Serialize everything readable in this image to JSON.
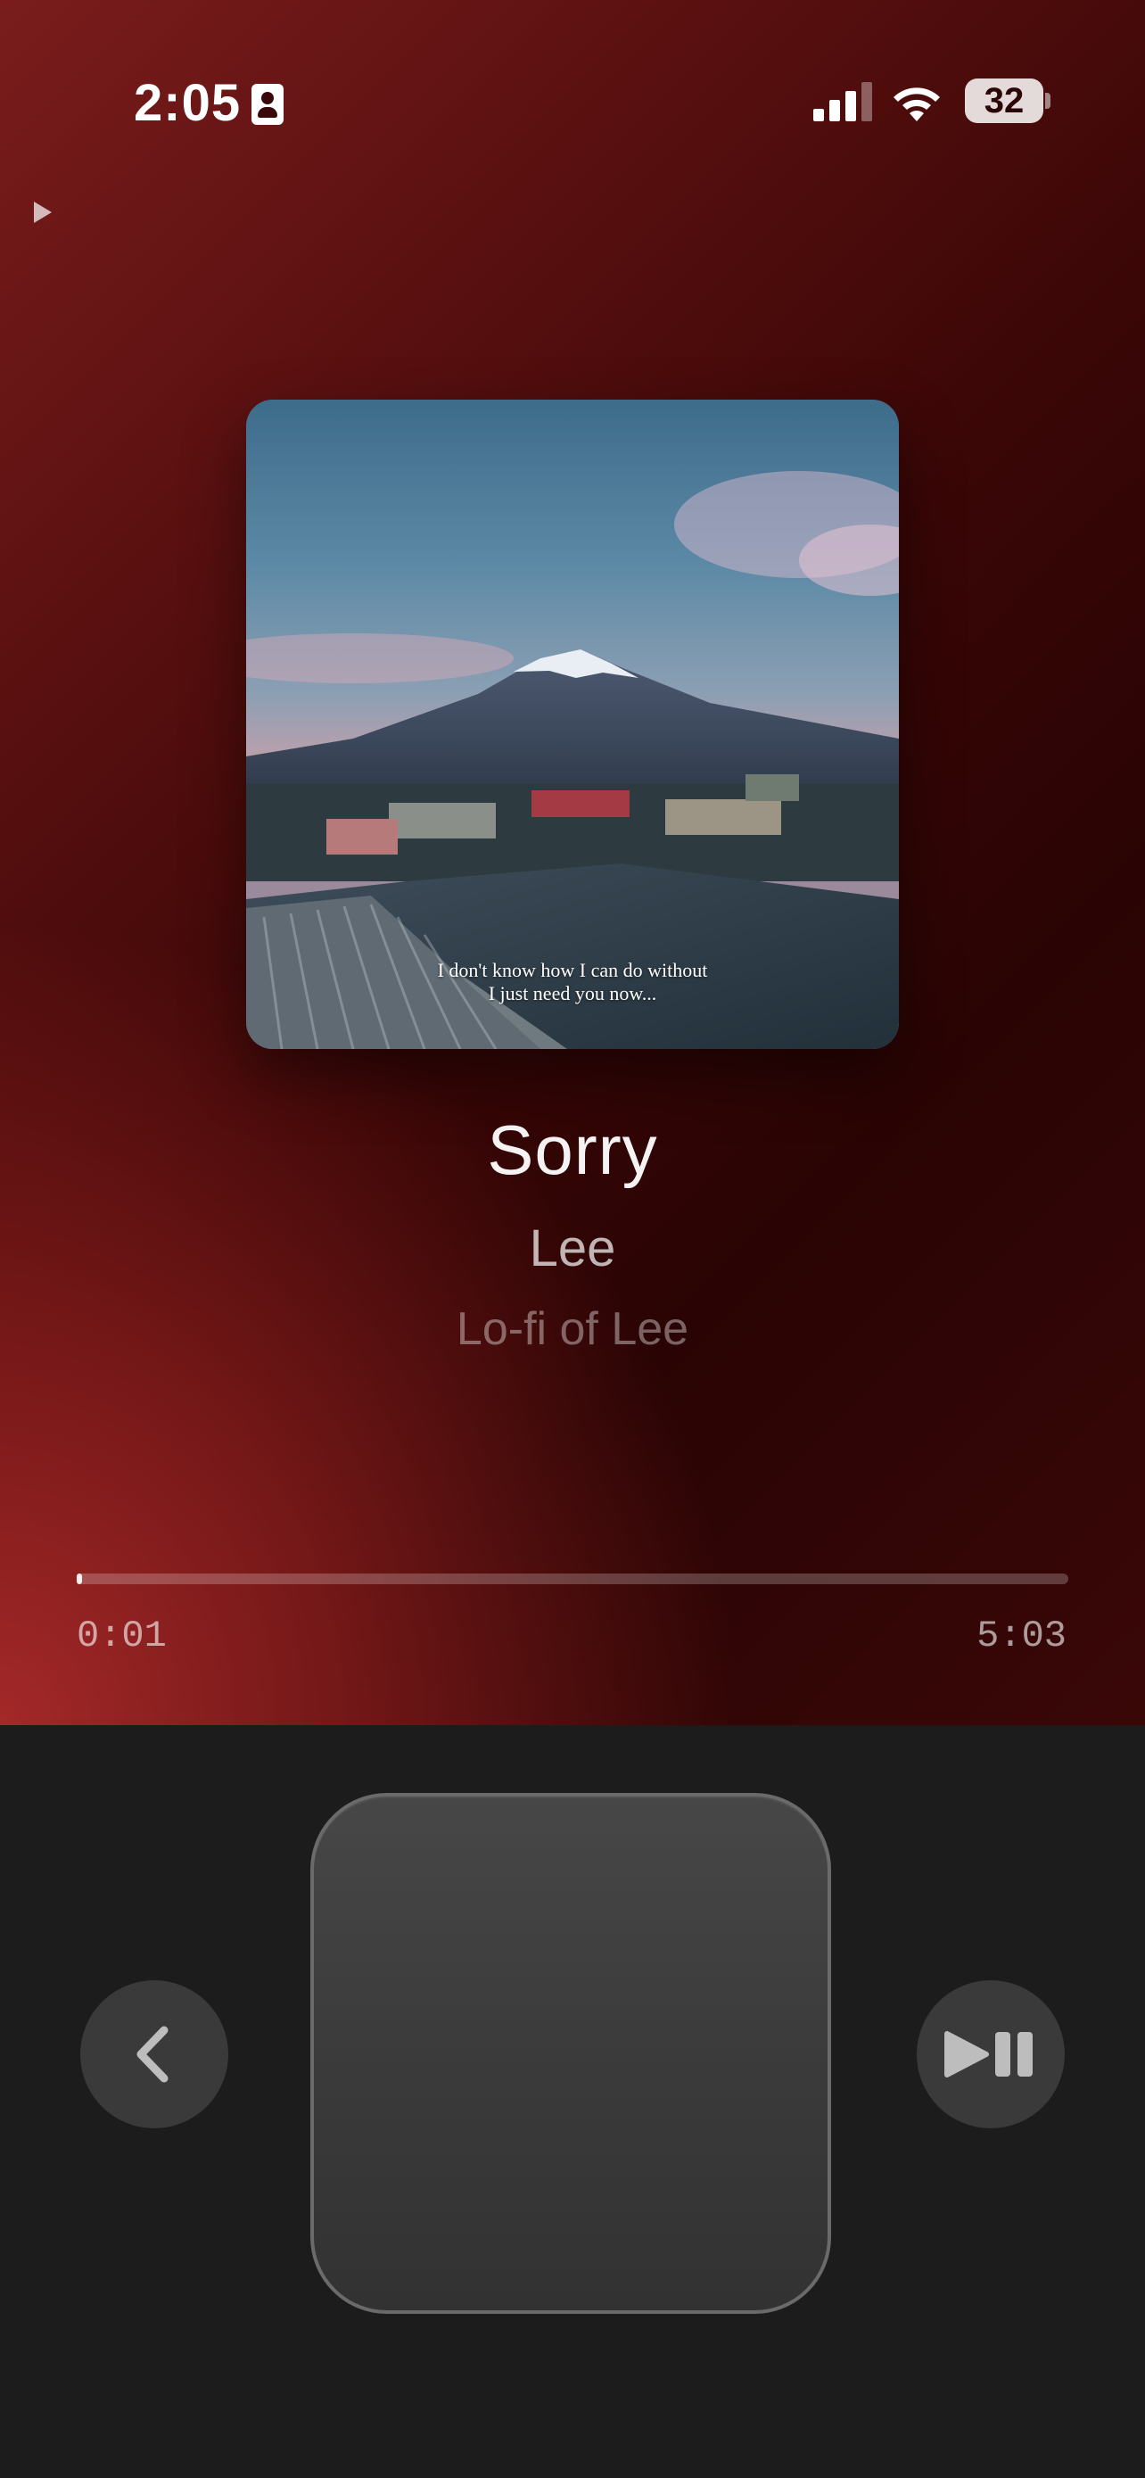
{
  "status_bar": {
    "time": "2:05",
    "battery": "32",
    "icons": [
      "contact-card-icon",
      "cellular-signal-icon",
      "wifi-icon",
      "battery-icon"
    ]
  },
  "mini_player": {
    "icon": "play-icon"
  },
  "now_playing": {
    "artwork_caption_line1": "I don't know how I can do without",
    "artwork_caption_line2": "I just need you now...",
    "title": "Sorry",
    "artist": "Lee",
    "album": "Lo-fi of Lee"
  },
  "progress": {
    "elapsed": "0:01",
    "duration": "5:03",
    "fraction": 0.003
  },
  "controls": {
    "back_icon": "chevron-left-icon",
    "play_pause_icon": "play-pause-icon",
    "touchpad": "click-wheel-pad"
  },
  "colors": {
    "accent_red": "#a32a2a",
    "dark_red": "#2a0404",
    "control_panel": "#1c1c1c",
    "button": "#3a3a3a"
  }
}
